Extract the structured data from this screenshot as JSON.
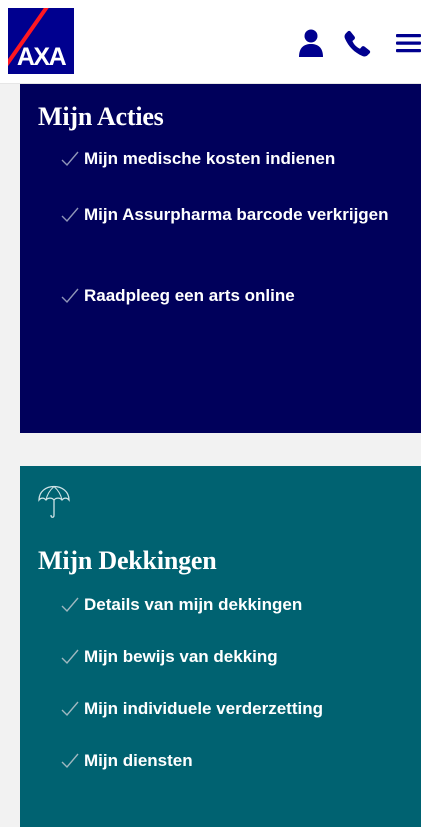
{
  "header": {
    "logo_text": "AXA",
    "icons": [
      "user-icon",
      "phone-icon",
      "menu-icon"
    ]
  },
  "actions": {
    "title": "Mijn Acties",
    "items": [
      {
        "label": "Mijn medische kosten indienen"
      },
      {
        "label": "Mijn Assurpharma barcode verkrijgen"
      },
      {
        "label": "Raadpleeg een arts online"
      }
    ]
  },
  "coverage": {
    "icon": "umbrella-icon",
    "title": "Mijn Dekkingen",
    "items": [
      {
        "label": "Details van mijn dekkingen"
      },
      {
        "label": "Mijn bewijs van dekking"
      },
      {
        "label": "Mijn individuele verderzetting"
      },
      {
        "label": "Mijn diensten"
      }
    ]
  },
  "colors": {
    "brand_blue": "#00008f",
    "brand_red": "#ff1721",
    "actions_panel": "#00005b",
    "coverage_panel": "#006271",
    "check": "#8f95b8"
  }
}
